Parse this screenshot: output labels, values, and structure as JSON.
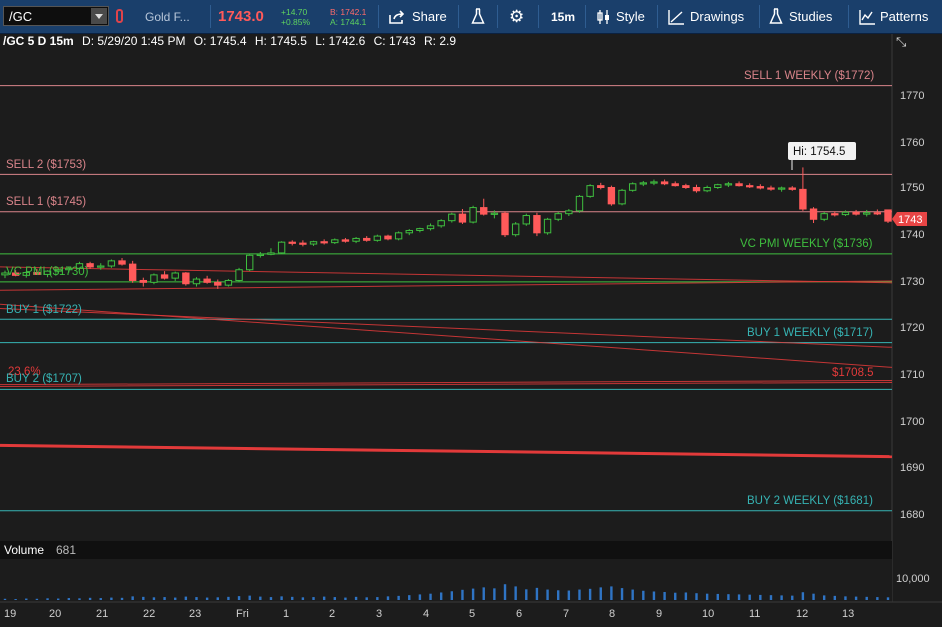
{
  "toolbar": {
    "symbol": "/GC",
    "description": "Gold F...",
    "last_price": "1743.0",
    "change": "+14.70",
    "change_pct": "+0.85%",
    "bid": "B: 1742.1",
    "ask": "A: 1744.1",
    "share_label": "Share",
    "timeframe_label": "15m",
    "style_label": "Style",
    "drawings_label": "Drawings",
    "studies_label": "Studies",
    "patterns_label": "Patterns"
  },
  "info_bar": {
    "series": "/GC 5 D 15m",
    "date": "D: 5/29/20 1:45 PM",
    "open": "O: 1745.4",
    "high": "H: 1745.5",
    "low": "L: 1742.6",
    "close": "C: 1743",
    "range": "R: 2.9"
  },
  "annotations": {
    "sell1_weekly": "SELL 1 WEEKLY ($1772)",
    "sell2": "SELL 2 ($1753)",
    "sell1": "SELL 1 ($1745)",
    "hi_callout": "Hi: 1754.5",
    "vc_pmi_weekly": "VC PMI WEEKLY ($1736)",
    "vc_pmi": "VC PMI ($1730)",
    "buy1": "BUY 1 ($1722)",
    "buy1_weekly": "BUY 1 WEEKLY ($1717)",
    "fib": "23.6%",
    "buy2": "BUY 2 ($1707)",
    "trend_price": "$1708.5",
    "buy2_weekly": "BUY 2 WEEKLY ($1681)",
    "current_price_tag": "1743"
  },
  "price_axis": [
    "1770",
    "1760",
    "1750",
    "1740",
    "1730",
    "1720",
    "1710",
    "1700",
    "1690",
    "1680"
  ],
  "time_axis": [
    "19",
    "20",
    "21",
    "22",
    "23",
    "Fri",
    "1",
    "2",
    "3",
    "4",
    "5",
    "6",
    "7",
    "8",
    "9",
    "10",
    "11",
    "12",
    "13"
  ],
  "volume": {
    "title": "Volume",
    "value": "681",
    "axis_label": "10,000"
  },
  "colors": {
    "up": "#3fbf3f",
    "down": "#ff5a5a",
    "sell_line": "#d9848a",
    "buy_line": "#36b3b3",
    "pmi_line": "#3fbf3f",
    "trend_line": "#e23a3a",
    "toolbar": "#1a3f6b"
  },
  "chart_data": {
    "type": "candlestick",
    "price_range": [
      1677,
      1779
    ],
    "candles": [
      {
        "o": 1731.5,
        "h": 1732.4,
        "l": 1730.8,
        "c": 1731.9
      },
      {
        "o": 1731.9,
        "h": 1732.5,
        "l": 1731.2,
        "c": 1731.4
      },
      {
        "o": 1731.4,
        "h": 1732.3,
        "l": 1730.9,
        "c": 1732.0
      },
      {
        "o": 1732.0,
        "h": 1732.8,
        "l": 1731.5,
        "c": 1731.6
      },
      {
        "o": 1731.6,
        "h": 1732.5,
        "l": 1731.0,
        "c": 1732.3
      },
      {
        "o": 1732.3,
        "h": 1733.1,
        "l": 1731.8,
        "c": 1732.6
      },
      {
        "o": 1732.6,
        "h": 1733.2,
        "l": 1732.0,
        "c": 1732.9
      },
      {
        "o": 1732.9,
        "h": 1734.3,
        "l": 1732.5,
        "c": 1733.9
      },
      {
        "o": 1733.9,
        "h": 1734.3,
        "l": 1732.8,
        "c": 1733.2
      },
      {
        "o": 1733.2,
        "h": 1734.0,
        "l": 1732.6,
        "c": 1733.4
      },
      {
        "o": 1733.4,
        "h": 1734.8,
        "l": 1733.0,
        "c": 1734.5
      },
      {
        "o": 1734.5,
        "h": 1735.1,
        "l": 1733.5,
        "c": 1733.8
      },
      {
        "o": 1733.8,
        "h": 1734.5,
        "l": 1729.8,
        "c": 1730.3
      },
      {
        "o": 1730.3,
        "h": 1730.9,
        "l": 1729.0,
        "c": 1729.9
      },
      {
        "o": 1729.9,
        "h": 1731.8,
        "l": 1729.5,
        "c": 1731.5
      },
      {
        "o": 1731.5,
        "h": 1732.3,
        "l": 1730.5,
        "c": 1730.8
      },
      {
        "o": 1730.8,
        "h": 1732.2,
        "l": 1730.2,
        "c": 1731.9
      },
      {
        "o": 1731.9,
        "h": 1732.1,
        "l": 1729.2,
        "c": 1729.6
      },
      {
        "o": 1729.6,
        "h": 1731.0,
        "l": 1729.0,
        "c": 1730.6
      },
      {
        "o": 1730.6,
        "h": 1731.3,
        "l": 1729.6,
        "c": 1729.9
      },
      {
        "o": 1729.9,
        "h": 1730.5,
        "l": 1728.5,
        "c": 1729.3
      },
      {
        "o": 1729.3,
        "h": 1730.6,
        "l": 1729.0,
        "c": 1730.3
      },
      {
        "o": 1730.3,
        "h": 1733.0,
        "l": 1730.0,
        "c": 1732.6
      },
      {
        "o": 1732.6,
        "h": 1735.9,
        "l": 1732.3,
        "c": 1735.7
      },
      {
        "o": 1735.7,
        "h": 1736.4,
        "l": 1735.2,
        "c": 1735.9
      },
      {
        "o": 1735.9,
        "h": 1737.2,
        "l": 1735.7,
        "c": 1736.2
      },
      {
        "o": 1736.2,
        "h": 1738.7,
        "l": 1736.0,
        "c": 1738.5
      },
      {
        "o": 1738.5,
        "h": 1738.9,
        "l": 1737.8,
        "c": 1738.3
      },
      {
        "o": 1738.3,
        "h": 1738.9,
        "l": 1737.6,
        "c": 1738.1
      },
      {
        "o": 1738.1,
        "h": 1738.8,
        "l": 1737.7,
        "c": 1738.6
      },
      {
        "o": 1738.6,
        "h": 1739.1,
        "l": 1738.0,
        "c": 1738.4
      },
      {
        "o": 1738.4,
        "h": 1739.3,
        "l": 1738.1,
        "c": 1739.0
      },
      {
        "o": 1739.0,
        "h": 1739.4,
        "l": 1738.4,
        "c": 1738.7
      },
      {
        "o": 1738.7,
        "h": 1739.6,
        "l": 1738.3,
        "c": 1739.3
      },
      {
        "o": 1739.3,
        "h": 1739.8,
        "l": 1738.6,
        "c": 1738.9
      },
      {
        "o": 1738.9,
        "h": 1740.1,
        "l": 1738.6,
        "c": 1739.8
      },
      {
        "o": 1739.8,
        "h": 1740.1,
        "l": 1738.9,
        "c": 1739.2
      },
      {
        "o": 1739.2,
        "h": 1740.8,
        "l": 1738.9,
        "c": 1740.5
      },
      {
        "o": 1740.5,
        "h": 1741.3,
        "l": 1740.0,
        "c": 1741.0
      },
      {
        "o": 1741.0,
        "h": 1741.6,
        "l": 1740.6,
        "c": 1741.4
      },
      {
        "o": 1741.4,
        "h": 1742.5,
        "l": 1741.0,
        "c": 1742.0
      },
      {
        "o": 1742.0,
        "h": 1743.4,
        "l": 1741.6,
        "c": 1743.1
      },
      {
        "o": 1743.1,
        "h": 1744.8,
        "l": 1742.7,
        "c": 1744.5
      },
      {
        "o": 1744.5,
        "h": 1745.6,
        "l": 1742.4,
        "c": 1742.8
      },
      {
        "o": 1742.8,
        "h": 1746.3,
        "l": 1742.5,
        "c": 1745.9
      },
      {
        "o": 1745.9,
        "h": 1747.8,
        "l": 1744.2,
        "c": 1744.5
      },
      {
        "o": 1744.5,
        "h": 1745.3,
        "l": 1743.6,
        "c": 1744.7
      },
      {
        "o": 1744.7,
        "h": 1745.1,
        "l": 1739.6,
        "c": 1740.1
      },
      {
        "o": 1740.1,
        "h": 1742.8,
        "l": 1739.7,
        "c": 1742.4
      },
      {
        "o": 1742.4,
        "h": 1744.6,
        "l": 1742.0,
        "c": 1744.2
      },
      {
        "o": 1744.2,
        "h": 1744.8,
        "l": 1739.8,
        "c": 1740.5
      },
      {
        "o": 1740.5,
        "h": 1743.7,
        "l": 1740.1,
        "c": 1743.4
      },
      {
        "o": 1743.4,
        "h": 1745.0,
        "l": 1743.0,
        "c": 1744.6
      },
      {
        "o": 1744.6,
        "h": 1745.6,
        "l": 1744.1,
        "c": 1745.2
      },
      {
        "o": 1745.2,
        "h": 1748.6,
        "l": 1744.8,
        "c": 1748.3
      },
      {
        "o": 1748.3,
        "h": 1750.9,
        "l": 1748.0,
        "c": 1750.6
      },
      {
        "o": 1750.6,
        "h": 1751.2,
        "l": 1749.8,
        "c": 1750.2
      },
      {
        "o": 1750.2,
        "h": 1750.6,
        "l": 1746.3,
        "c": 1746.7
      },
      {
        "o": 1746.7,
        "h": 1749.9,
        "l": 1746.4,
        "c": 1749.6
      },
      {
        "o": 1749.6,
        "h": 1751.3,
        "l": 1749.3,
        "c": 1751.0
      },
      {
        "o": 1751.0,
        "h": 1751.6,
        "l": 1750.5,
        "c": 1751.2
      },
      {
        "o": 1751.2,
        "h": 1751.9,
        "l": 1750.7,
        "c": 1751.4
      },
      {
        "o": 1751.4,
        "h": 1751.9,
        "l": 1750.7,
        "c": 1751.0
      },
      {
        "o": 1751.0,
        "h": 1751.5,
        "l": 1750.4,
        "c": 1750.6
      },
      {
        "o": 1750.6,
        "h": 1751.0,
        "l": 1749.9,
        "c": 1750.2
      },
      {
        "o": 1750.2,
        "h": 1750.8,
        "l": 1749.1,
        "c": 1749.5
      },
      {
        "o": 1749.5,
        "h": 1750.6,
        "l": 1749.2,
        "c": 1750.2
      },
      {
        "o": 1750.2,
        "h": 1751.0,
        "l": 1749.9,
        "c": 1750.8
      },
      {
        "o": 1750.8,
        "h": 1751.4,
        "l": 1750.3,
        "c": 1751.0
      },
      {
        "o": 1751.0,
        "h": 1751.5,
        "l": 1750.4,
        "c": 1750.6
      },
      {
        "o": 1750.6,
        "h": 1751.1,
        "l": 1750.1,
        "c": 1750.4
      },
      {
        "o": 1750.4,
        "h": 1750.9,
        "l": 1749.8,
        "c": 1750.1
      },
      {
        "o": 1750.1,
        "h": 1750.6,
        "l": 1749.5,
        "c": 1749.9
      },
      {
        "o": 1749.9,
        "h": 1750.4,
        "l": 1749.3,
        "c": 1750.1
      },
      {
        "o": 1750.1,
        "h": 1750.5,
        "l": 1749.5,
        "c": 1749.8
      },
      {
        "o": 1749.8,
        "h": 1754.5,
        "l": 1745.2,
        "c": 1745.6
      },
      {
        "o": 1745.6,
        "h": 1746.0,
        "l": 1742.6,
        "c": 1743.4
      },
      {
        "o": 1743.4,
        "h": 1745.0,
        "l": 1743.0,
        "c": 1744.6
      },
      {
        "o": 1744.6,
        "h": 1745.1,
        "l": 1744.0,
        "c": 1744.4
      },
      {
        "o": 1744.4,
        "h": 1745.3,
        "l": 1744.1,
        "c": 1744.9
      },
      {
        "o": 1744.9,
        "h": 1745.4,
        "l": 1744.2,
        "c": 1744.5
      },
      {
        "o": 1744.5,
        "h": 1745.4,
        "l": 1744.0,
        "c": 1744.8
      },
      {
        "o": 1744.8,
        "h": 1745.5,
        "l": 1744.3,
        "c": 1744.6
      },
      {
        "o": 1745.4,
        "h": 1745.5,
        "l": 1742.6,
        "c": 1743.0
      }
    ],
    "levels": [
      {
        "price": 1772,
        "kind": "sell"
      },
      {
        "price": 1753,
        "kind": "sell"
      },
      {
        "price": 1745,
        "kind": "sell"
      },
      {
        "price": 1736,
        "kind": "pmi"
      },
      {
        "price": 1730,
        "kind": "pmi"
      },
      {
        "price": 1722,
        "kind": "buy"
      },
      {
        "price": 1717,
        "kind": "buy"
      },
      {
        "price": 1707,
        "kind": "buy"
      },
      {
        "price": 1681,
        "kind": "buy"
      }
    ],
    "trend_lines": [
      {
        "from": 1733.2,
        "to": 1729.8,
        "weight": "thin"
      },
      {
        "from": 1728.2,
        "to": 1730.2,
        "weight": "thin"
      },
      {
        "from": 1725.2,
        "to": 1711.7,
        "weight": "thin"
      },
      {
        "from": 1724.3,
        "to": 1716.0,
        "weight": "thin"
      },
      {
        "from": 1707.6,
        "to": 1708.5,
        "weight": "thin"
      },
      {
        "from": 1708.0,
        "to": 1708.9,
        "weight": "thin"
      },
      {
        "from": 1695.0,
        "to": 1692.6,
        "weight": "thick"
      }
    ],
    "volume_max": 14000,
    "volumes": [
      500,
      400,
      600,
      500,
      700,
      600,
      800,
      700,
      900,
      800,
      1000,
      900,
      1500,
      1300,
      1100,
      1200,
      1000,
      1400,
      1200,
      1000,
      1100,
      1300,
      1600,
      1800,
      1400,
      1200,
      1500,
      1300,
      1100,
      1200,
      1400,
      1200,
      1000,
      1300,
      1100,
      1200,
      1500,
      1700,
      2000,
      2300,
      2600,
      3100,
      3600,
      4200,
      4700,
      5200,
      4800,
      6500,
      5600,
      4400,
      5000,
      4300,
      4000,
      3900,
      4300,
      4600,
      5200,
      5600,
      4900,
      4300,
      3800,
      3500,
      3300,
      3000,
      3100,
      2800,
      2600,
      2500,
      2400,
      2300,
      2200,
      2100,
      2000,
      1900,
      1800,
      3200,
      2600,
      1900,
      1700,
      1500,
      1400,
      1300,
      1200,
      1100
    ]
  }
}
